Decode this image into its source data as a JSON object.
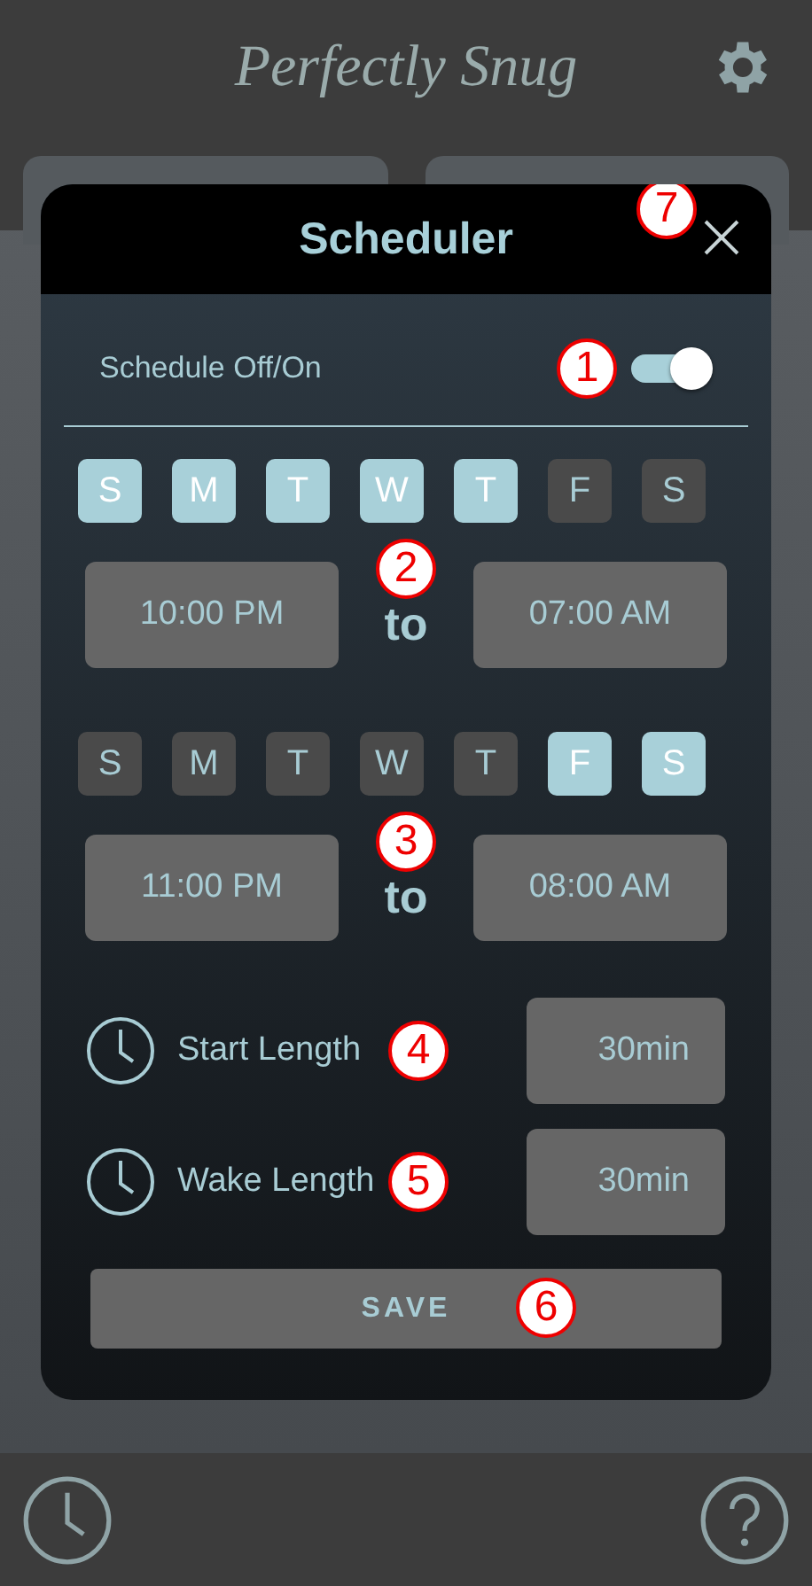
{
  "app": {
    "title": "Perfectly Snug"
  },
  "dialog": {
    "title": "Scheduler",
    "close_callout": "7"
  },
  "schedule_toggle": {
    "label": "Schedule Off/On",
    "on": true,
    "callout": "1"
  },
  "schedules": [
    {
      "days": [
        {
          "label": "S",
          "selected": true
        },
        {
          "label": "M",
          "selected": true
        },
        {
          "label": "T",
          "selected": true
        },
        {
          "label": "W",
          "selected": true
        },
        {
          "label": "T",
          "selected": true
        },
        {
          "label": "F",
          "selected": false
        },
        {
          "label": "S",
          "selected": false
        }
      ],
      "start": "10:00 PM",
      "separator": "to",
      "end": "07:00 AM",
      "callout": "2"
    },
    {
      "days": [
        {
          "label": "S",
          "selected": false
        },
        {
          "label": "M",
          "selected": false
        },
        {
          "label": "T",
          "selected": false
        },
        {
          "label": "W",
          "selected": false
        },
        {
          "label": "T",
          "selected": false
        },
        {
          "label": "F",
          "selected": true
        },
        {
          "label": "S",
          "selected": true
        }
      ],
      "start": "11:00 PM",
      "separator": "to",
      "end": "08:00 AM",
      "callout": "3"
    }
  ],
  "lengths": [
    {
      "label": "Start Length",
      "value": "30min",
      "callout": "4"
    },
    {
      "label": "Wake Length",
      "value": "30min",
      "callout": "5"
    }
  ],
  "save": {
    "label": "SAVE",
    "callout": "6"
  }
}
